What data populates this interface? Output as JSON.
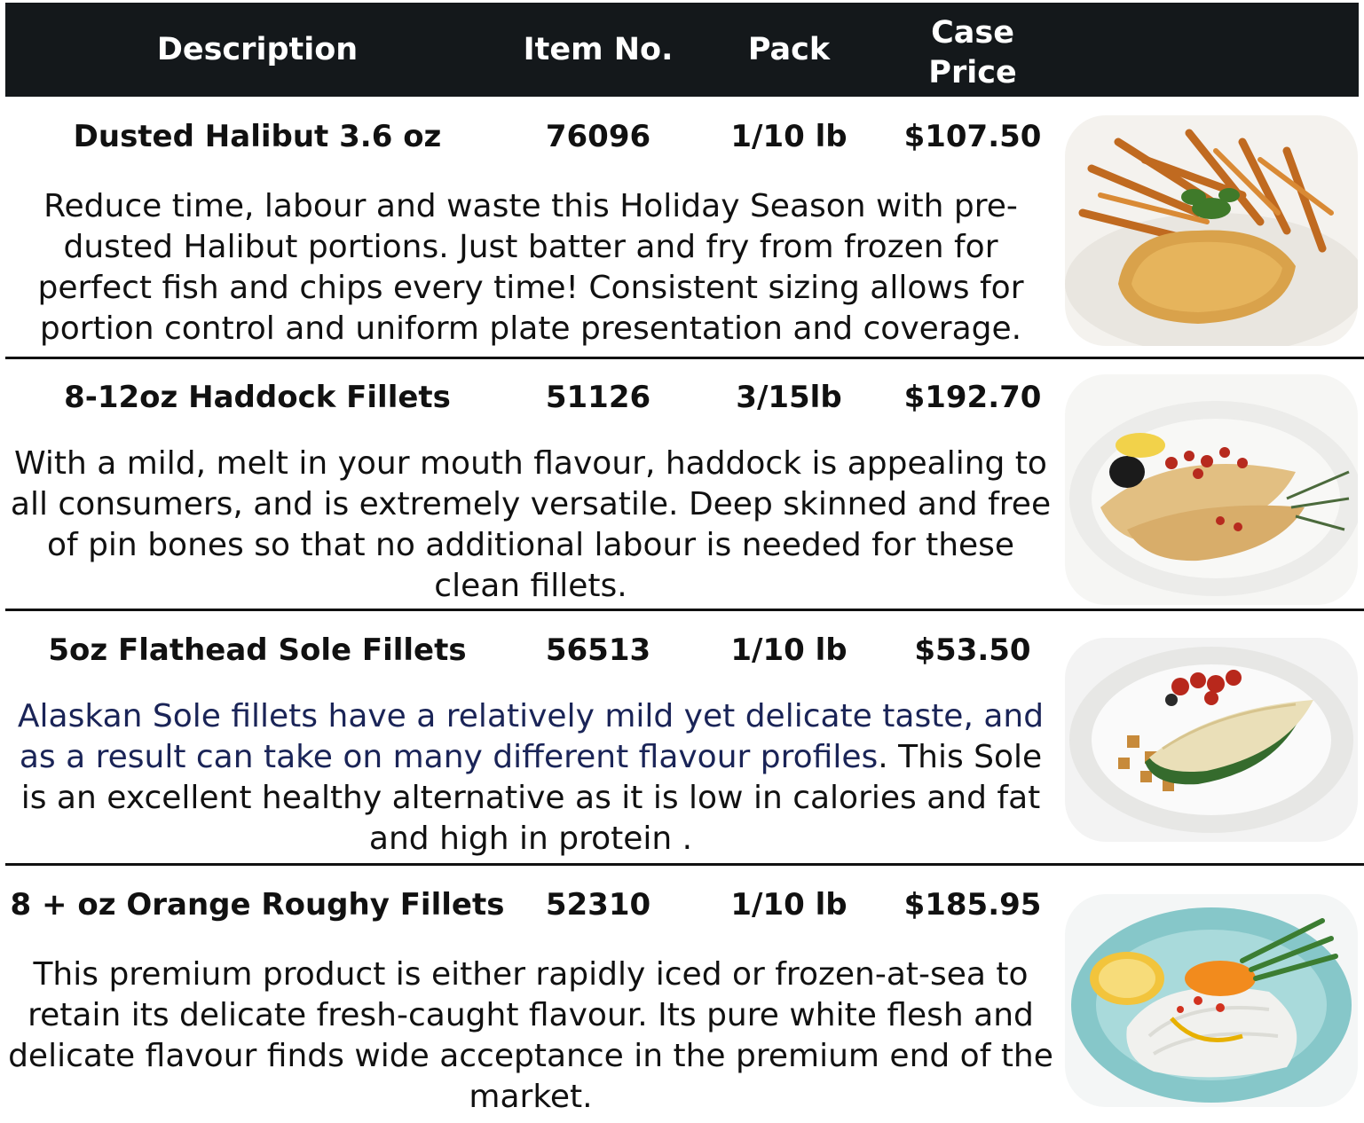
{
  "header": {
    "description": "Description",
    "item_no": "Item No.",
    "pack": "Pack",
    "case_price_line1": "Case",
    "case_price_line2": "Price"
  },
  "products": [
    {
      "name": "Dusted Halibut 3.6 oz",
      "item_no": "76096",
      "pack": "1/10 lb",
      "price": "$107.50",
      "description": "Reduce time, labour and waste this Holiday Season with pre-dusted Halibut portions. Just batter and fry from frozen for perfect fish and chips every time! Consistent sizing allows for portion control and uniform plate presentation and coverage.",
      "photo": "fish-and-chips-photo"
    },
    {
      "name": "8-12oz Haddock Fillets",
      "item_no": "51126",
      "pack": "3/15lb",
      "price": "$192.70",
      "description": "With a mild, melt in your mouth flavour, haddock is appealing to all consumers, and is extremely versatile.  Deep skinned and free of pin bones so that no additional labour is needed for these clean fillets.",
      "photo": "haddock-plate-photo"
    },
    {
      "name": "5oz Flathead Sole Fillets",
      "item_no": "56513",
      "pack": "1/10 lb",
      "price": "$53.50",
      "description_part1": "Alaskan Sole fillets have a relatively mild yet delicate taste, and as a result can take on many different flavour profiles",
      "description_part2": ". This Sole is an excellent healthy alternative as it is low in calories and fat and high in protein .",
      "accent_color": "#1a2457",
      "photo": "sole-plate-photo"
    },
    {
      "name": "8 + oz Orange Roughy Fillets",
      "item_no": "52310",
      "pack": "1/10 lb",
      "price": "$185.95",
      "description": "This premium product is either rapidly iced or frozen-at-sea to retain its delicate fresh-caught flavour. Its pure white flesh and delicate flavour finds wide acceptance in the premium end of the market.",
      "photo": "orange-roughy-plate-photo"
    }
  ]
}
